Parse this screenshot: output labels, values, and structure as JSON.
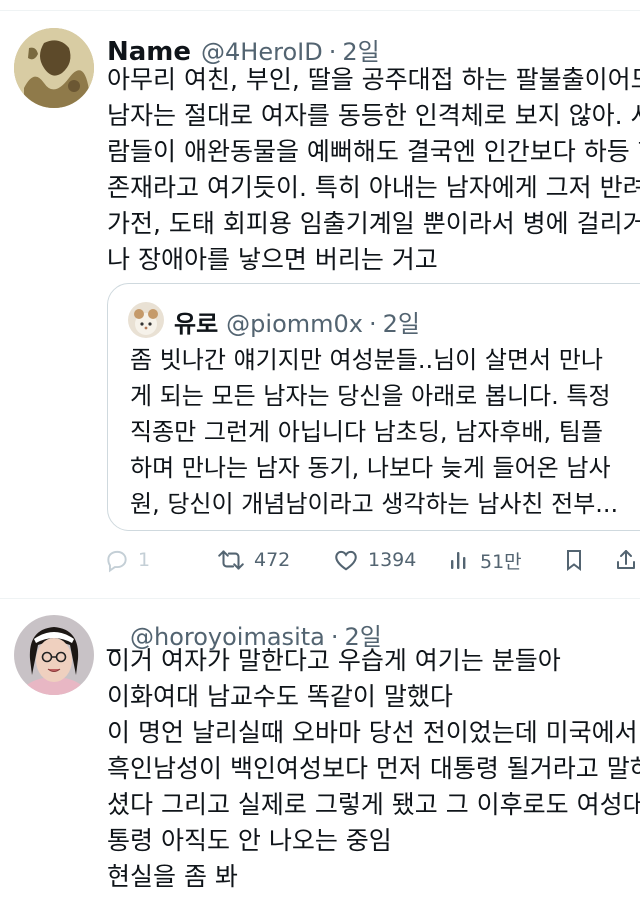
{
  "tweet1": {
    "name": "Name",
    "handle": "@4HeroID",
    "time": "2일",
    "lines": [
      "아무리 여친, 부인, 딸을 공주대접 하는 팔불출이어도",
      "남자는 절대로 여자를 동등한 인격체로 보지 않아. 사",
      "람들이 애완동물을 예뻐해도 결국엔 인간보다 하등 한",
      "존재라고 여기듯이. 특히 아내는 남자에게 그저 반려",
      "가전, 도태 회피용 임출기계일 뿐이라서 병에 걸리거",
      "나 장애아를 낳으면 버리는 거고"
    ],
    "quote": {
      "name": "유로",
      "handle": "@piomm0x",
      "time": "2일",
      "lines": [
        "좀 빗나간 얘기지만 여성분들..님이 살면서 만나",
        "게 되는 모든 남자는 당신을 아래로 봅니다. 특정",
        "직종만 그런게 아닙니다 남초딩, 남자후배, 팀플",
        "하며 만나는 남자 동기, 나보다 늦게 들어온 남사",
        "원, 당신이 개념남이라고 생각하는 남사친 전부..."
      ]
    },
    "actions": {
      "reply_count": "1",
      "retweet_count": "472",
      "like_count": "1394",
      "views_count": "51만"
    }
  },
  "tweet2": {
    "name": "_",
    "handle": "@horoyoimasita",
    "time": "2일",
    "lines": [
      "이거 여자가 말한다고 우습게 여기는 분들아",
      "이화여대 남교수도 똑같이 말했다",
      "이 명언 날리실때 오바마 당선 전이었는데 미국에서",
      "흑인남성이 백인여성보다 먼저 대통령 될거라고 말하",
      "셨다 그리고 실제로 그렇게 됐고 그 이후로도 여성대",
      "통령 아직도 안 나오는 중임",
      "현실을 좀 봐"
    ]
  },
  "colors": {
    "text": "#0f1419",
    "secondary": "#536471",
    "border": "#cfd9de"
  }
}
